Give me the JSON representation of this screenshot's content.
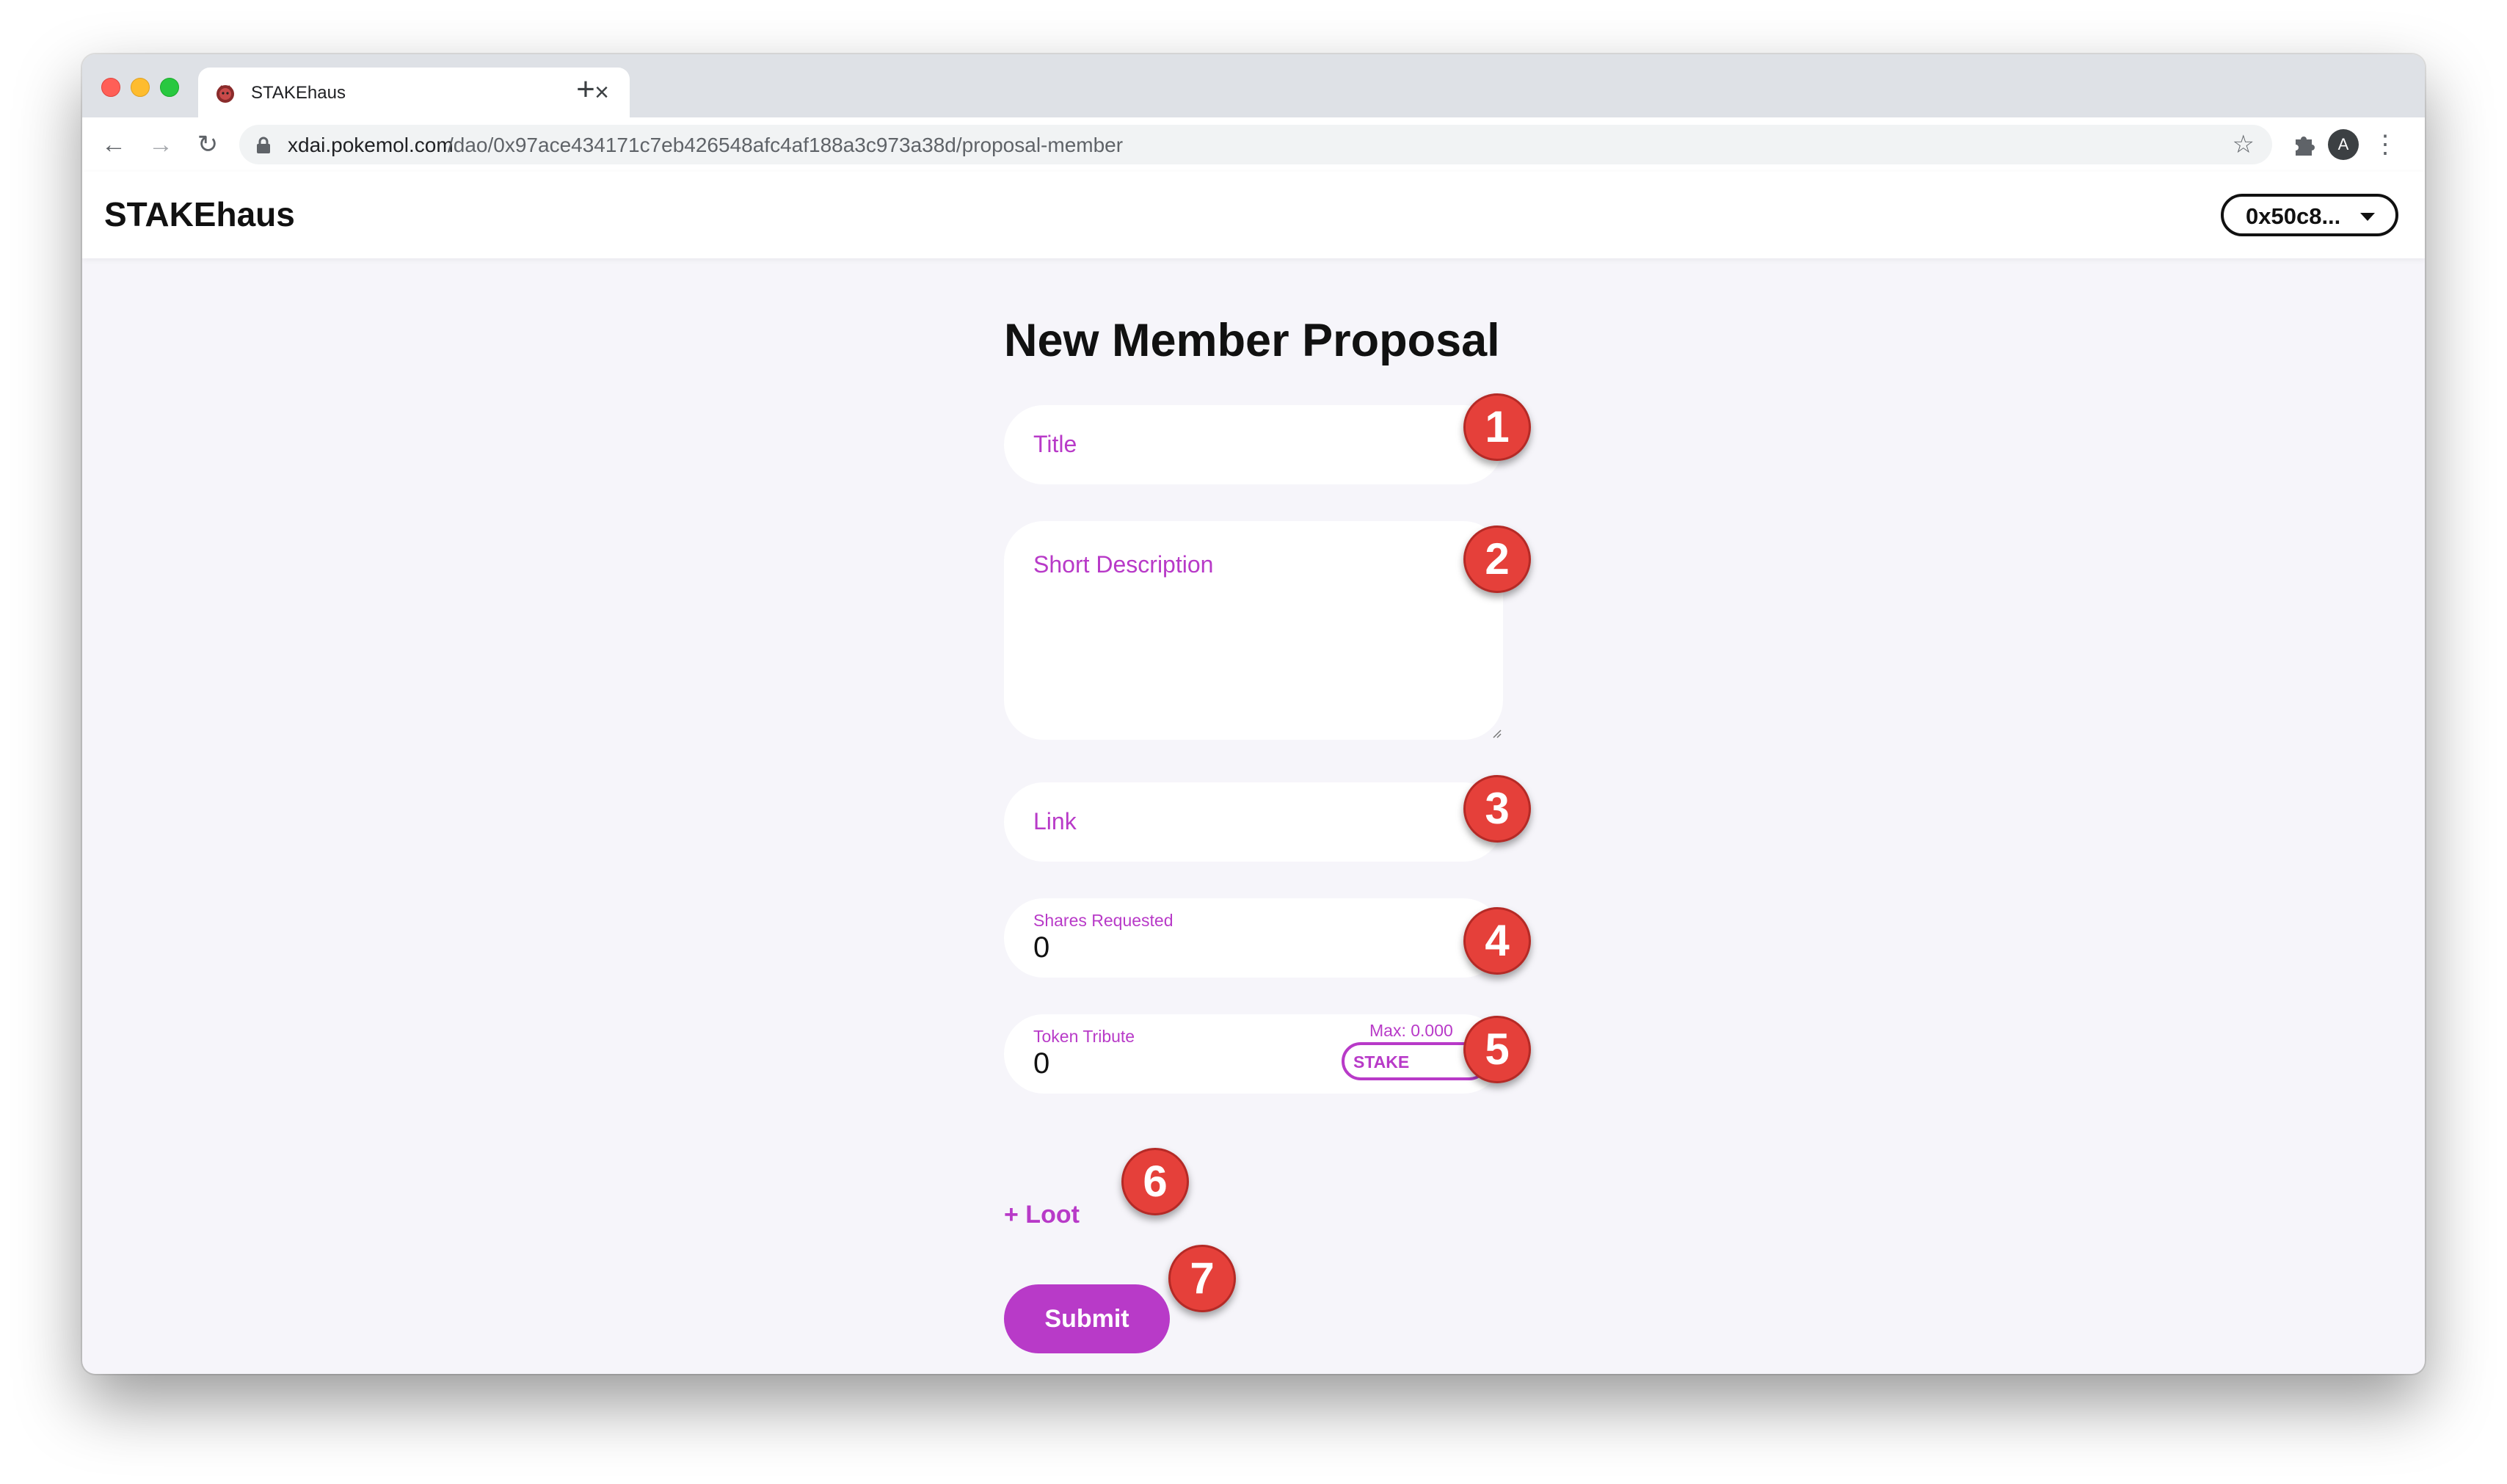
{
  "browser": {
    "tab_title": "STAKEhaus",
    "tab_close": "×",
    "new_tab": "+",
    "url_host": "xdai.pokemol.com",
    "url_path": "/dao/0x97ace434171c7eb426548afc4af188a3c973a38d/proposal-member",
    "profile_initial": "A",
    "icons": {
      "back": "arrow-left",
      "forward": "arrow-right",
      "reload": "reload",
      "lock": "lock",
      "bookmark": "star",
      "extensions": "puzzle",
      "menu": "more-vertical"
    }
  },
  "app": {
    "brand": "STAKEhaus",
    "account": "0x50c8..."
  },
  "form": {
    "title": "New Member Proposal",
    "title_placeholder": "Title",
    "description_placeholder": "Short Description",
    "link_placeholder": "Link",
    "shares_label": "Shares Requested",
    "shares_value": "0",
    "tribute_label": "Token Tribute",
    "tribute_value": "0",
    "tribute_max": "Max: 0.000",
    "tribute_token": "STAKE",
    "loot_label": "+ Loot",
    "submit_label": "Submit"
  },
  "markers": [
    "1",
    "2",
    "3",
    "4",
    "5",
    "6",
    "7"
  ],
  "colors": {
    "accent": "#b83ac8",
    "marker": "#e5403a",
    "page_bg": "#f6f5fa"
  }
}
